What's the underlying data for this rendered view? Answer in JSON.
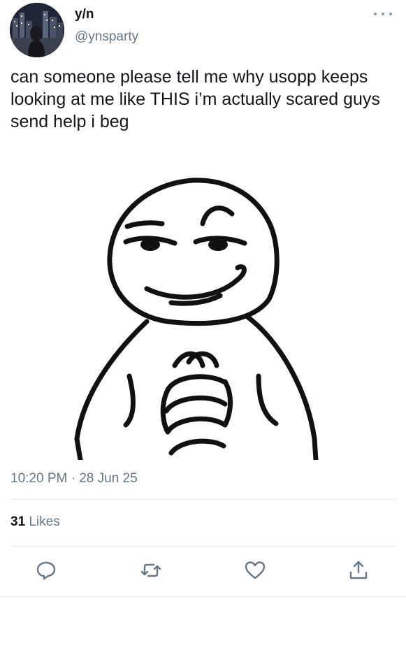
{
  "tweet": {
    "display_name": "y/n",
    "handle": "@ynsparty",
    "text": "can someone please tell me why usopp keeps looking at me like THIS i’m actually scared guys send help i beg",
    "timestamp": "10:20 PM · 28 Jun 25",
    "likes_count": "31",
    "likes_label": "Likes"
  },
  "icons": {
    "more": "more-horizontal-icon",
    "reply": "reply-icon",
    "retweet": "retweet-icon",
    "like": "heart-icon",
    "share": "share-icon"
  },
  "colors": {
    "text": "#14171a",
    "secondary": "#657786",
    "icon": "#657786",
    "divider": "#e1e8ed"
  }
}
